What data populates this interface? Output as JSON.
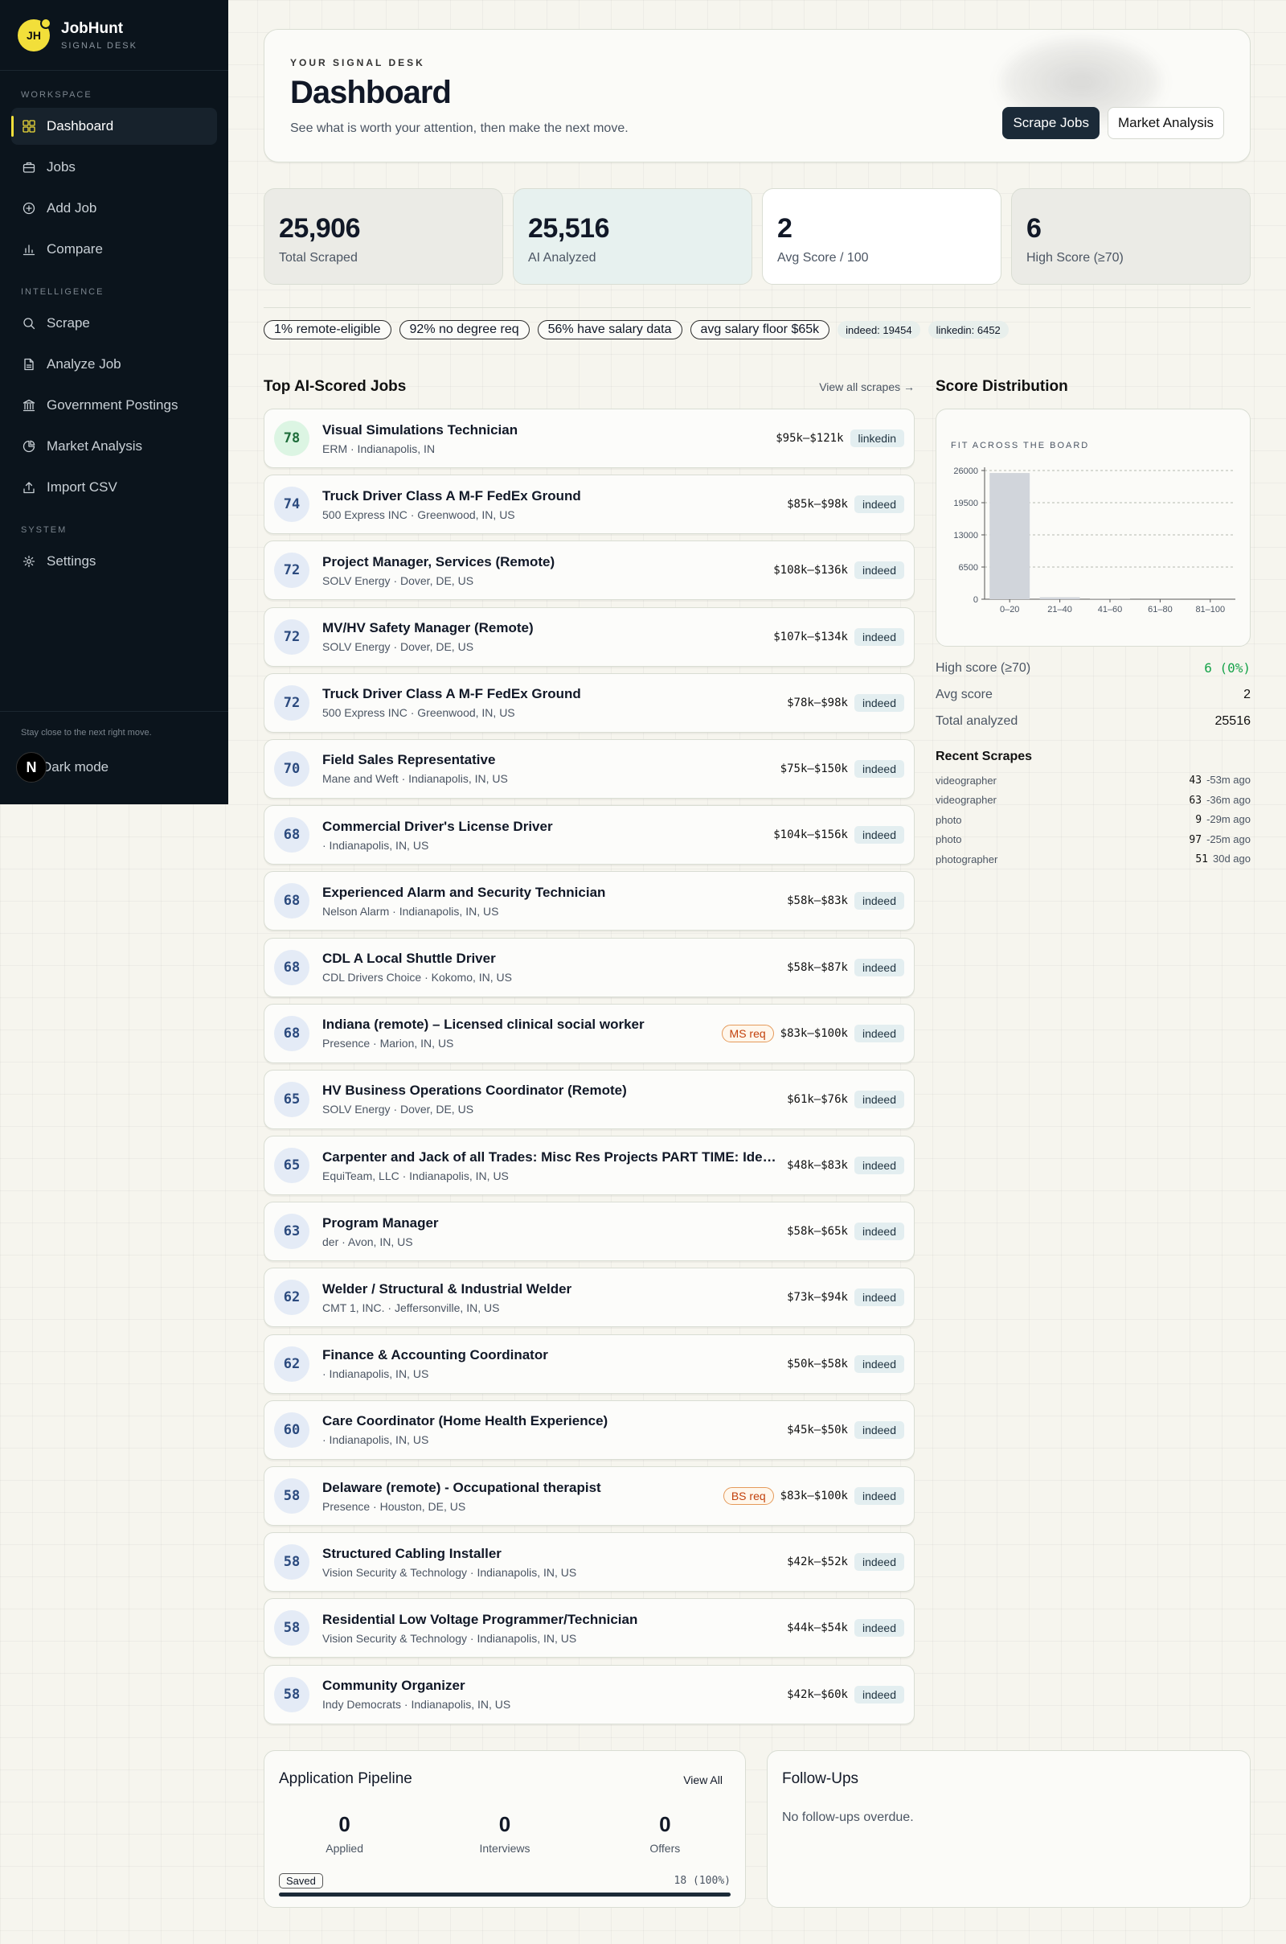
{
  "brand": {
    "initials": "JH",
    "name": "JobHunt",
    "subtitle": "SIGNAL DESK"
  },
  "sidebar": {
    "sections": [
      {
        "label": "WORKSPACE",
        "items": [
          {
            "label": "Dashboard",
            "icon": "grid-icon",
            "active": true
          },
          {
            "label": "Jobs",
            "icon": "briefcase-icon"
          },
          {
            "label": "Add Job",
            "icon": "plus-circle-icon"
          },
          {
            "label": "Compare",
            "icon": "bar-chart-icon"
          }
        ]
      },
      {
        "label": "INTELLIGENCE",
        "items": [
          {
            "label": "Scrape",
            "icon": "search-icon"
          },
          {
            "label": "Analyze Job",
            "icon": "document-icon"
          },
          {
            "label": "Government Postings",
            "icon": "building-icon"
          },
          {
            "label": "Market Analysis",
            "icon": "pie-icon"
          },
          {
            "label": "Import CSV",
            "icon": "upload-icon"
          }
        ]
      },
      {
        "label": "SYSTEM",
        "items": [
          {
            "label": "Settings",
            "icon": "gear-icon"
          }
        ]
      }
    ],
    "footer_note": "Stay close to the next right move.",
    "dark_mode_label": "Dark mode",
    "avatar_letter": "N"
  },
  "hero": {
    "eyebrow": "YOUR SIGNAL DESK",
    "title": "Dashboard",
    "subtitle": "See what is worth your attention, then make the next move.",
    "primary_button": "Scrape Jobs",
    "secondary_button": "Market Analysis"
  },
  "stats": [
    {
      "value": "25,906",
      "label": "Total Scraped",
      "bg": "#ebebe6"
    },
    {
      "value": "25,516",
      "label": "AI Analyzed",
      "bg": "#e7f1ef"
    },
    {
      "value": "2",
      "label": "Avg Score / 100",
      "bg": "#ffffff"
    },
    {
      "value": "6",
      "label": "High Score (≥70)",
      "bg": "#ebebe6"
    }
  ],
  "chips": [
    {
      "label": "1% remote-eligible"
    },
    {
      "label": "92% no degree req"
    },
    {
      "label": "56% have salary data"
    },
    {
      "label": "avg salary floor $65k"
    },
    {
      "label": "indeed: 19454",
      "small": true
    },
    {
      "label": "linkedin: 6452",
      "small": true
    }
  ],
  "jobs_section": {
    "title": "Top AI-Scored Jobs",
    "view_all": "View all scrapes →"
  },
  "jobs": [
    {
      "score": "78",
      "title": "Visual Simulations Technician",
      "meta": "ERM · Indianapolis, IN",
      "salary": "$95k–$121k",
      "source": "linkedin",
      "top": true
    },
    {
      "score": "74",
      "title": "Truck Driver Class A M-F FedEx Ground",
      "meta": "500 Express INC · Greenwood, IN, US",
      "salary": "$85k–$98k",
      "source": "indeed"
    },
    {
      "score": "72",
      "title": "Project Manager, Services (Remote)",
      "meta": "SOLV Energy · Dover, DE, US",
      "salary": "$108k–$136k",
      "source": "indeed"
    },
    {
      "score": "72",
      "title": "MV/HV Safety Manager (Remote)",
      "meta": "SOLV Energy · Dover, DE, US",
      "salary": "$107k–$134k",
      "source": "indeed"
    },
    {
      "score": "72",
      "title": "Truck Driver Class A M-F FedEx Ground",
      "meta": "500 Express INC · Greenwood, IN, US",
      "salary": "$78k–$98k",
      "source": "indeed"
    },
    {
      "score": "70",
      "title": "Field Sales Representative",
      "meta": "Mane and Weft · Indianapolis, IN, US",
      "salary": "$75k–$150k",
      "source": "indeed"
    },
    {
      "score": "68",
      "title": "Commercial Driver's License Driver",
      "meta": " · Indianapolis, IN, US",
      "salary": "$104k–$156k",
      "source": "indeed"
    },
    {
      "score": "68",
      "title": "Experienced Alarm and Security Technician",
      "meta": "Nelson Alarm · Indianapolis, IN, US",
      "salary": "$58k–$83k",
      "source": "indeed"
    },
    {
      "score": "68",
      "title": "CDL A Local Shuttle Driver",
      "meta": "CDL Drivers Choice · Kokomo, IN, US",
      "salary": "$58k–$87k",
      "source": "indeed"
    },
    {
      "score": "68",
      "title": "Indiana (remote) – Licensed clinical social worker",
      "meta": "Presence · Marion, IN, US",
      "salary": "$83k–$100k",
      "source": "indeed",
      "req": "MS req"
    },
    {
      "score": "65",
      "title": "HV Business Operations Coordinator (Remote)",
      "meta": "SOLV Energy · Dover, DE, US",
      "salary": "$61k–$76k",
      "source": "indeed"
    },
    {
      "score": "65",
      "title": "Carpenter and Jack of all Trades: Misc Res Projects PART TIME: Idea...",
      "meta": "EquiTeam, LLC · Indianapolis, IN, US",
      "salary": "$48k–$83k",
      "source": "indeed"
    },
    {
      "score": "63",
      "title": "Program Manager",
      "meta": "der · Avon, IN, US",
      "salary": "$58k–$65k",
      "source": "indeed"
    },
    {
      "score": "62",
      "title": "Welder / Structural & Industrial Welder",
      "meta": "CMT 1, INC. · Jeffersonville, IN, US",
      "salary": "$73k–$94k",
      "source": "indeed"
    },
    {
      "score": "62",
      "title": "Finance & Accounting Coordinator",
      "meta": " · Indianapolis, IN, US",
      "salary": "$50k–$58k",
      "source": "indeed"
    },
    {
      "score": "60",
      "title": "Care Coordinator (Home Health Experience)",
      "meta": " · Indianapolis, IN, US",
      "salary": "$45k–$50k",
      "source": "indeed"
    },
    {
      "score": "58",
      "title": "Delaware (remote) - Occupational therapist",
      "meta": "Presence · Houston, DE, US",
      "salary": "$83k–$100k",
      "source": "indeed",
      "req": "BS req"
    },
    {
      "score": "58",
      "title": "Structured Cabling Installer",
      "meta": "Vision Security & Technology · Indianapolis, IN, US",
      "salary": "$42k–$52k",
      "source": "indeed"
    },
    {
      "score": "58",
      "title": "Residential Low Voltage Programmer/Technician",
      "meta": "Vision Security & Technology · Indianapolis, IN, US",
      "salary": "$44k–$54k",
      "source": "indeed"
    },
    {
      "score": "58",
      "title": "Community Organizer",
      "meta": "Indy Democrats · Indianapolis, IN, US",
      "salary": "$42k–$60k",
      "source": "indeed"
    }
  ],
  "distribution": {
    "title": "Score Distribution",
    "chart_data": {
      "type": "bar",
      "title": "FIT ACROSS THE BOARD",
      "categories": [
        "0–20",
        "21–40",
        "41–60",
        "61–80",
        "81–100"
      ],
      "values": [
        25500,
        400,
        40,
        6,
        0
      ],
      "yticks": [
        "26000",
        "19500",
        "13000",
        "6500",
        "0"
      ],
      "ylim": [
        0,
        26000
      ],
      "grid": true,
      "bar_color": "#d1d5db"
    },
    "summary": [
      {
        "label": "High score (≥70)",
        "value": "6 (0%)",
        "green": true
      },
      {
        "label": "Avg score",
        "value": "2"
      },
      {
        "label": "Total analyzed",
        "value": "25516"
      }
    ],
    "recent_title": "Recent Scrapes",
    "recent": [
      {
        "term": "videographer",
        "count": "43",
        "ago": "-53m ago"
      },
      {
        "term": "videographer",
        "count": "63",
        "ago": "-36m ago"
      },
      {
        "term": "photo",
        "count": "9",
        "ago": "-29m ago"
      },
      {
        "term": "photo",
        "count": "97",
        "ago": "-25m ago"
      },
      {
        "term": "photographer",
        "count": "51",
        "ago": "30d ago"
      }
    ]
  },
  "pipeline": {
    "title": "Application Pipeline",
    "view_all": "View All",
    "stats": [
      {
        "value": "0",
        "label": "Applied"
      },
      {
        "value": "0",
        "label": "Interviews"
      },
      {
        "value": "0",
        "label": "Offers"
      }
    ],
    "saved_label": "Saved",
    "saved_value": "18 (100%)",
    "saved_fraction": 1.0
  },
  "followups": {
    "title": "Follow-Ups",
    "empty": "No follow-ups overdue."
  }
}
